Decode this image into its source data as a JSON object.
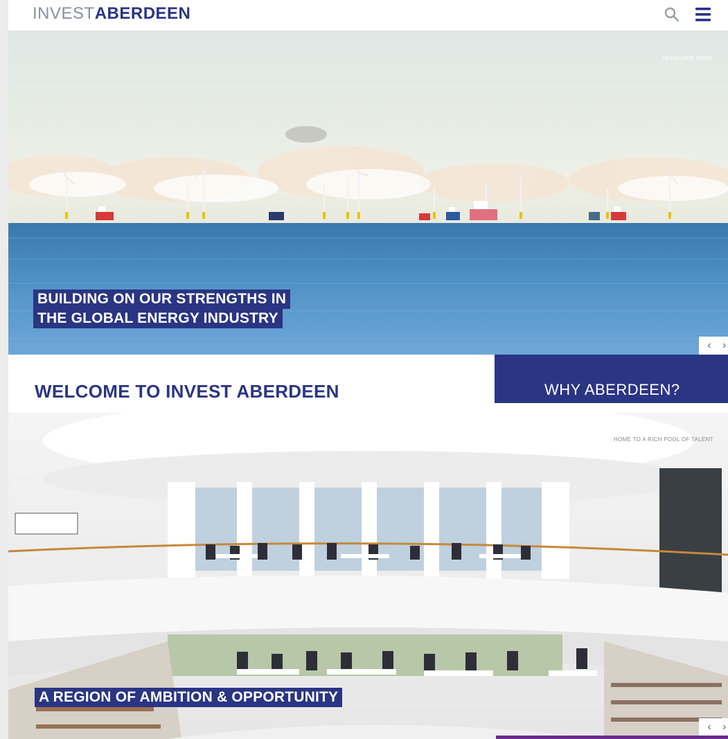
{
  "header": {
    "logo_light": "INVEST",
    "logo_bold": "ABERDEEN",
    "search_icon": "search-icon",
    "menu_icon": "hamburger-menu-icon"
  },
  "hero1": {
    "tag": "OFFSHORE WIND",
    "headline_line1": "BUILDING ON OUR STRENGTHS IN",
    "headline_line2": "THE GLOBAL ENERGY INDUSTRY",
    "prev_label": "‹",
    "next_label": "›"
  },
  "welcome": {
    "title": "WELCOME TO INVEST ABERDEEN",
    "cta_label": "WHY ABERDEEN?"
  },
  "hero2": {
    "tag": "HOME TO A RICH POOL OF TALENT",
    "headline": "A REGION OF AMBITION & OPPORTUNITY",
    "prev_label": "‹",
    "next_label": "›"
  },
  "colors": {
    "brand_navy": "#2a3583",
    "logo_grey": "#8a8f9c",
    "accent_purple": "#6b2a8c"
  }
}
